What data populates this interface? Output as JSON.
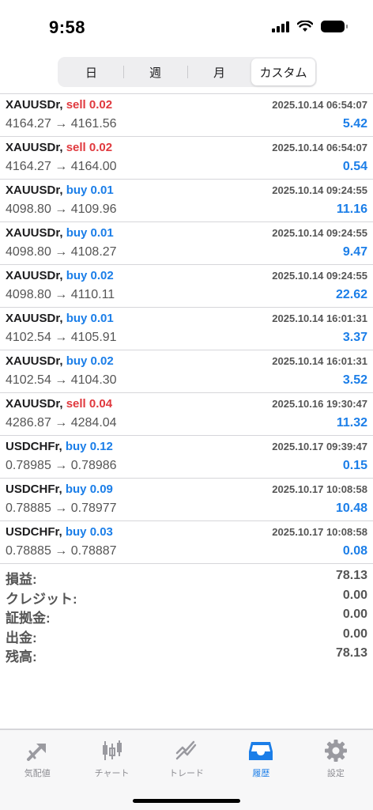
{
  "status_bar": {
    "time": "9:58"
  },
  "segmented": {
    "tabs": [
      "日",
      "週",
      "月",
      "カスタム"
    ],
    "active_index": 3
  },
  "colors": {
    "sell": "#e0393e",
    "buy": "#1b7ee8",
    "profit": "#1b7ee8",
    "accent": "#1b7ee8"
  },
  "deals": [
    {
      "symbol": "XAUUSDr,",
      "side": "sell 0.02",
      "type": "sell",
      "time": "2025.10.14 06:54:07",
      "prices": "4164.27 → 4161.56",
      "profit": "5.42"
    },
    {
      "symbol": "XAUUSDr,",
      "side": "sell 0.02",
      "type": "sell",
      "time": "2025.10.14 06:54:07",
      "prices": "4164.27 → 4164.00",
      "profit": "0.54"
    },
    {
      "symbol": "XAUUSDr,",
      "side": "buy 0.01",
      "type": "buy",
      "time": "2025.10.14 09:24:55",
      "prices": "4098.80 → 4109.96",
      "profit": "11.16"
    },
    {
      "symbol": "XAUUSDr,",
      "side": "buy 0.01",
      "type": "buy",
      "time": "2025.10.14 09:24:55",
      "prices": "4098.80 → 4108.27",
      "profit": "9.47"
    },
    {
      "symbol": "XAUUSDr,",
      "side": "buy 0.02",
      "type": "buy",
      "time": "2025.10.14 09:24:55",
      "prices": "4098.80 → 4110.11",
      "profit": "22.62"
    },
    {
      "symbol": "XAUUSDr,",
      "side": "buy 0.01",
      "type": "buy",
      "time": "2025.10.14 16:01:31",
      "prices": "4102.54 → 4105.91",
      "profit": "3.37"
    },
    {
      "symbol": "XAUUSDr,",
      "side": "buy 0.02",
      "type": "buy",
      "time": "2025.10.14 16:01:31",
      "prices": "4102.54 → 4104.30",
      "profit": "3.52"
    },
    {
      "symbol": "XAUUSDr,",
      "side": "sell 0.04",
      "type": "sell",
      "time": "2025.10.16 19:30:47",
      "prices": "4286.87 → 4284.04",
      "profit": "11.32"
    },
    {
      "symbol": "USDCHFr,",
      "side": "buy 0.12",
      "type": "buy",
      "time": "2025.10.17 09:39:47",
      "prices": "0.78985 → 0.78986",
      "profit": "0.15"
    },
    {
      "symbol": "USDCHFr,",
      "side": "buy 0.09",
      "type": "buy",
      "time": "2025.10.17 10:08:58",
      "prices": "0.78885 → 0.78977",
      "profit": "10.48"
    },
    {
      "symbol": "USDCHFr,",
      "side": "buy 0.03",
      "type": "buy",
      "time": "2025.10.17 10:08:58",
      "prices": "0.78885 → 0.78887",
      "profit": "0.08"
    }
  ],
  "summary": [
    {
      "label": "損益:",
      "value": "78.13"
    },
    {
      "label": "クレジット:",
      "value": "0.00"
    },
    {
      "label": "証拠金:",
      "value": "0.00"
    },
    {
      "label": "出金:",
      "value": "0.00"
    },
    {
      "label": "残高:",
      "value": "78.13"
    }
  ],
  "tabbar": {
    "items": [
      {
        "label": "気配値",
        "icon": "quotes-icon"
      },
      {
        "label": "チャート",
        "icon": "chart-icon"
      },
      {
        "label": "トレード",
        "icon": "trade-icon"
      },
      {
        "label": "履歴",
        "icon": "history-icon"
      },
      {
        "label": "設定",
        "icon": "settings-icon"
      }
    ],
    "active_index": 3
  }
}
